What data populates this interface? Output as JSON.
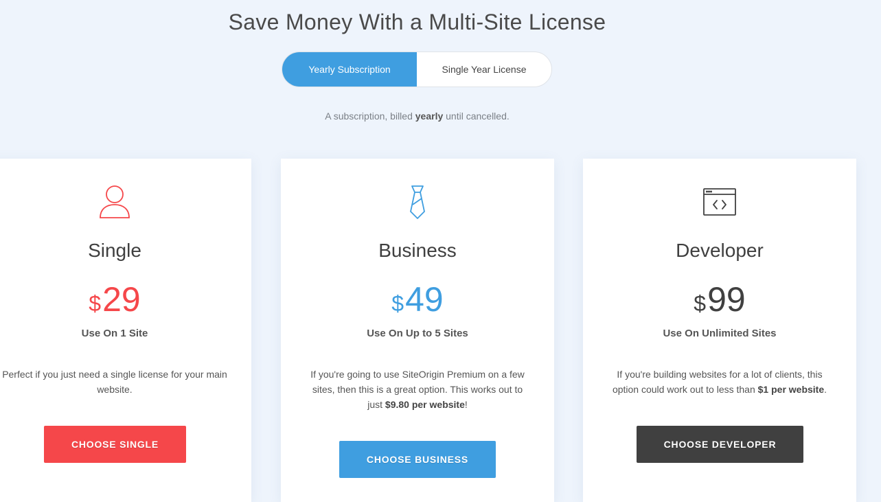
{
  "header": {
    "title": "Save Money With a Multi-Site License"
  },
  "billing_toggle": {
    "options": [
      {
        "label": "Yearly Subscription",
        "active": true
      },
      {
        "label": "Single Year License",
        "active": false
      }
    ]
  },
  "billing_note": {
    "prefix": "A subscription, billed ",
    "emphasis": "yearly",
    "suffix": " until cancelled."
  },
  "plans": [
    {
      "name": "Single",
      "icon": "user-icon",
      "currency": "$",
      "price": "29",
      "sites": "Use On 1 Site",
      "desc_prefix": "Perfect if you just need a single license for your main website.",
      "desc_emphasis": "",
      "desc_suffix": "",
      "button_label": "CHOOSE SINGLE",
      "color": "#f5474a"
    },
    {
      "name": "Business",
      "icon": "tie-icon",
      "currency": "$",
      "price": "49",
      "sites": "Use On Up to 5 Sites",
      "desc_prefix": "If you're going to use SiteOrigin Premium on a few sites, then this is a great option. This works out to just ",
      "desc_emphasis": "$9.80 per website",
      "desc_suffix": "!",
      "button_label": "CHOOSE BUSINESS",
      "color": "#3f9ee0"
    },
    {
      "name": "Developer",
      "icon": "code-window-icon",
      "currency": "$",
      "price": "99",
      "sites": "Use On Unlimited Sites",
      "desc_prefix": "If you're building websites for a lot of clients, this option could work out to less than ",
      "desc_emphasis": "$1 per website",
      "desc_suffix": ".",
      "button_label": "CHOOSE DEVELOPER",
      "color": "#404040"
    }
  ]
}
